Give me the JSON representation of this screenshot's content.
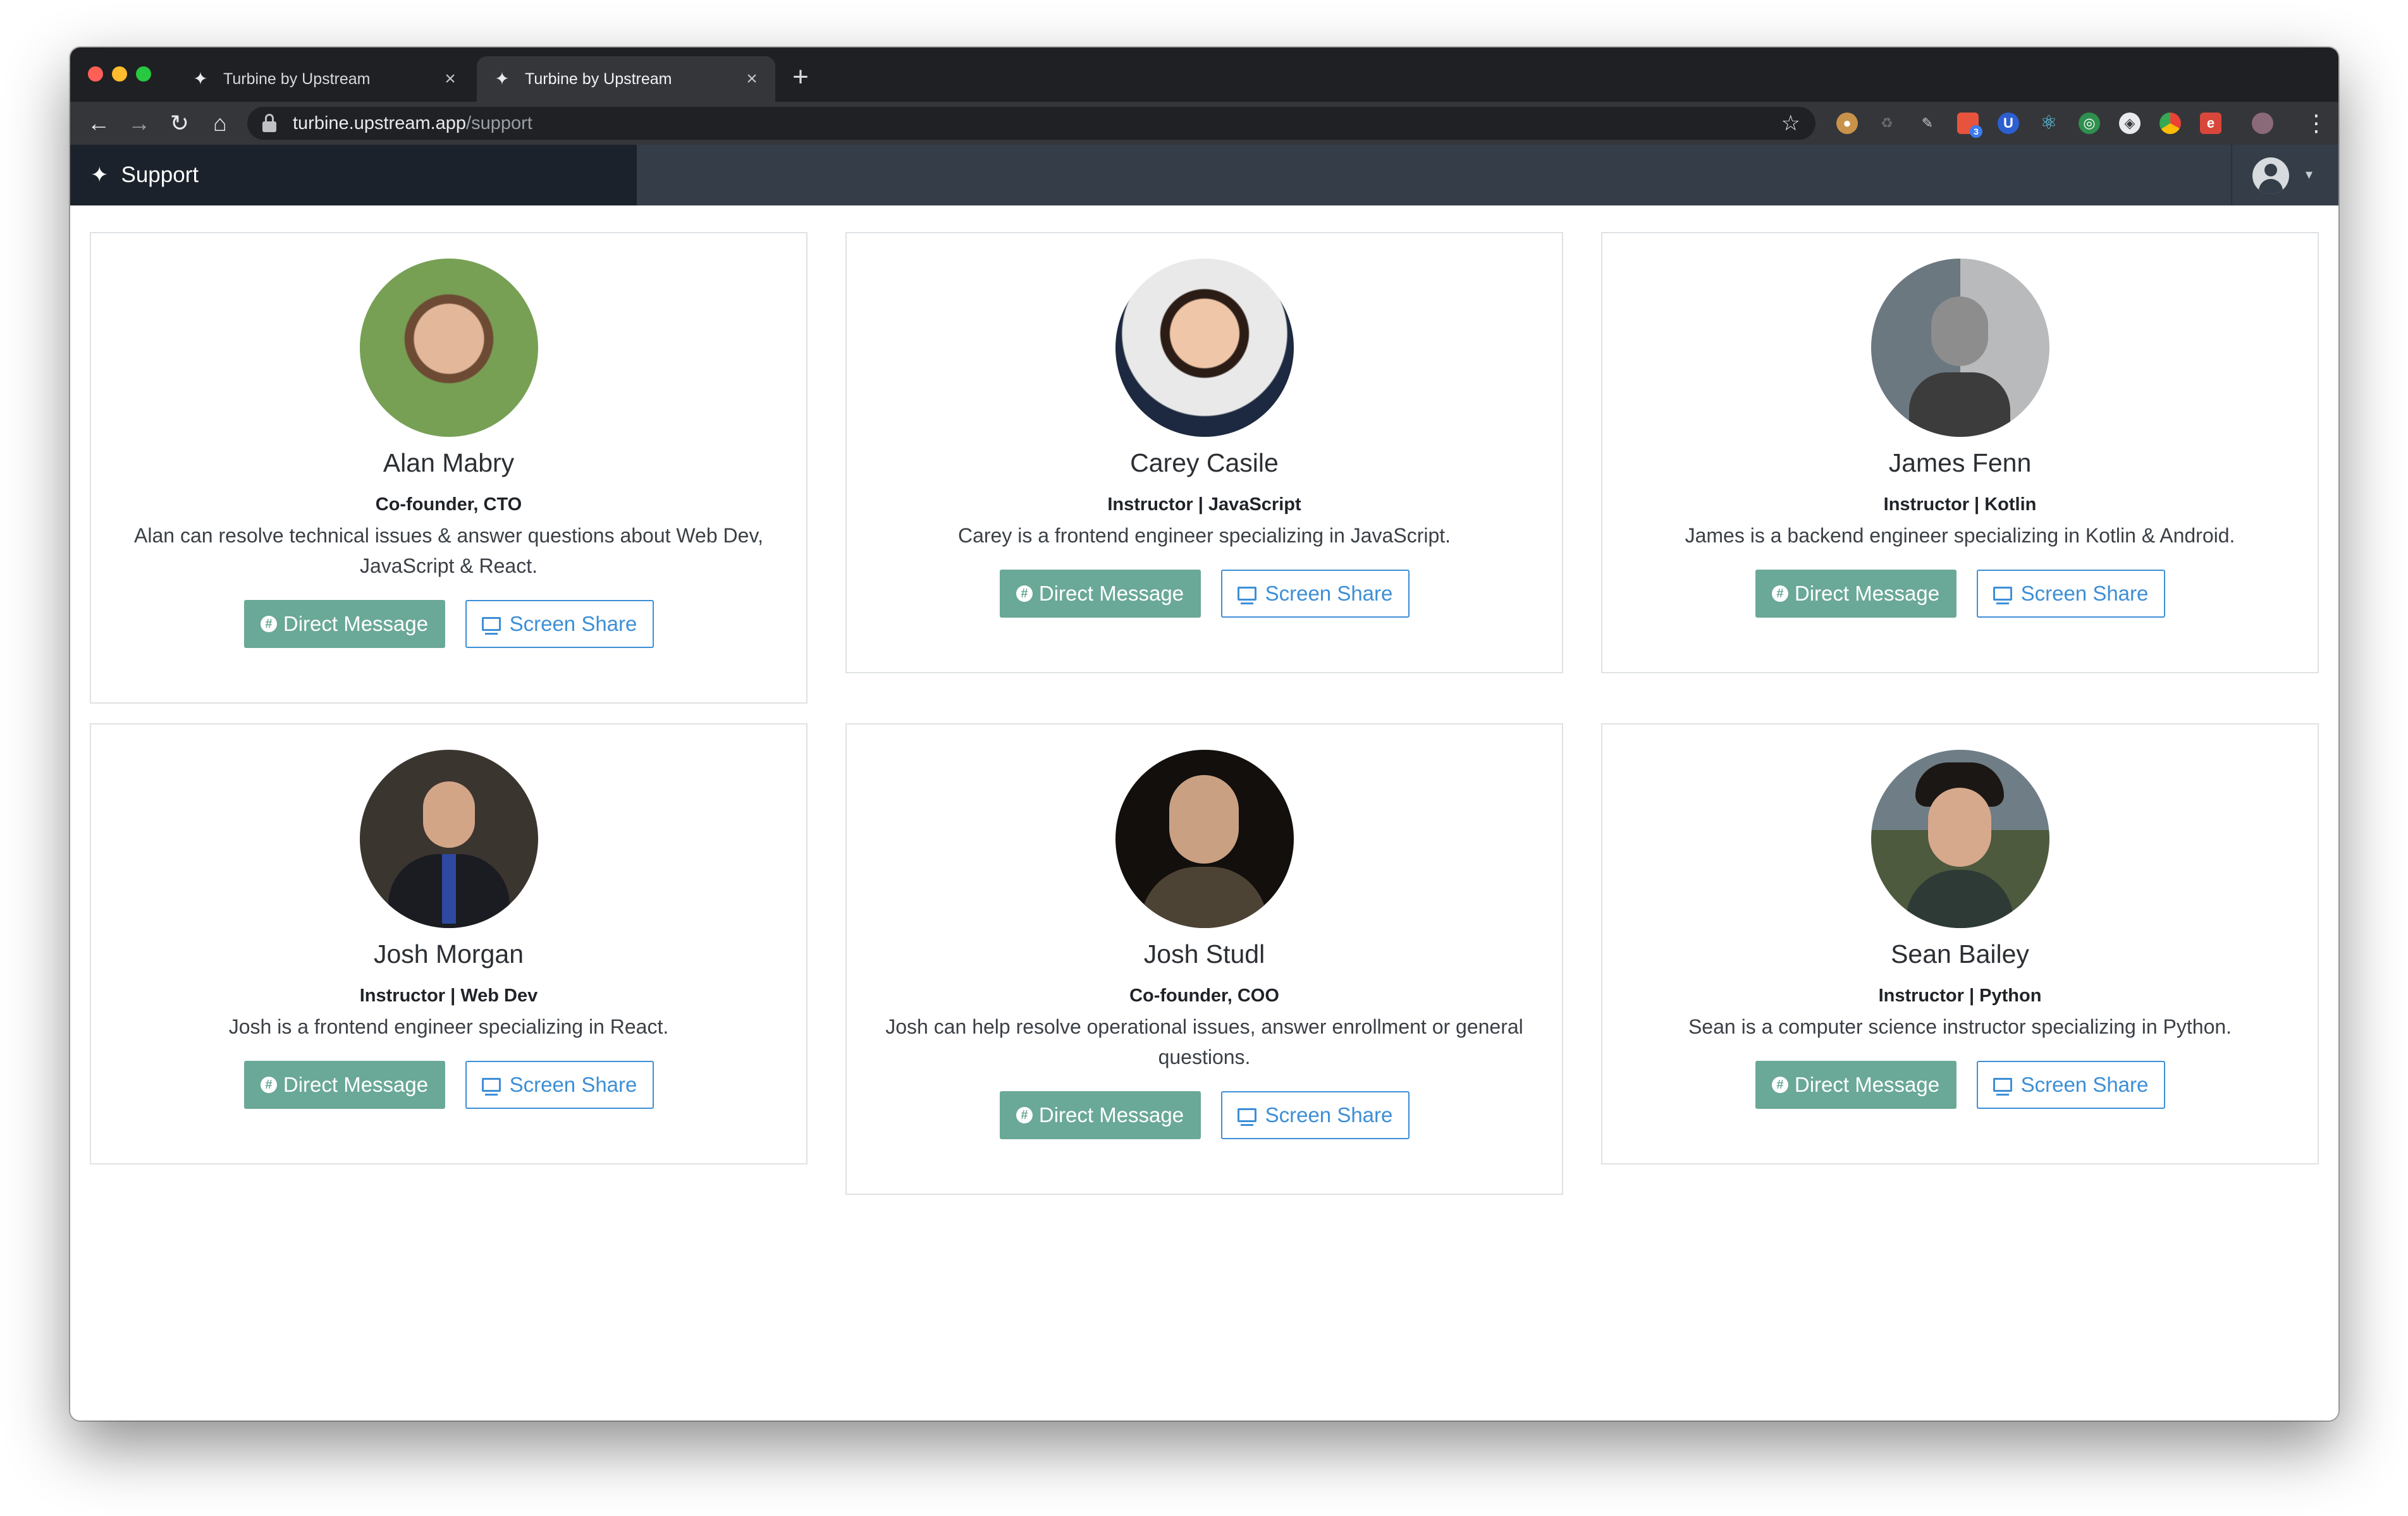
{
  "browser": {
    "tabs": [
      {
        "title": "Turbine by Upstream",
        "active": false
      },
      {
        "title": "Turbine by Upstream",
        "active": true
      }
    ],
    "url_host": "turbine.upstream.app",
    "url_path": "/support",
    "extension_icons": [
      "cookie-icon",
      "recycle-icon",
      "pen-icon",
      "extension-badge-icon",
      "upstream-u-icon",
      "react-icon",
      "target-icon",
      "compass-icon",
      "chrome-icon",
      "e-icon",
      "profile-avatar-icon"
    ],
    "extension_badge_count": "3"
  },
  "app": {
    "section_title": "Support"
  },
  "buttons": {
    "direct_message": "Direct Message",
    "screen_share": "Screen Share"
  },
  "team": [
    {
      "name": "Alan Mabry",
      "role": "Co-founder, CTO",
      "bio": "Alan can resolve technical issues & answer questions about Web Dev, JavaScript & React."
    },
    {
      "name": "Carey Casile",
      "role": "Instructor | JavaScript",
      "bio": "Carey is a frontend engineer specializing in JavaScript."
    },
    {
      "name": "James Fenn",
      "role": "Instructor | Kotlin",
      "bio": "James is a backend engineer specializing in Kotlin & Android."
    },
    {
      "name": "Josh Morgan",
      "role": "Instructor | Web Dev",
      "bio": "Josh is a frontend engineer specializing in React."
    },
    {
      "name": "Josh Studl",
      "role": "Co-founder, COO",
      "bio": "Josh can help resolve operational issues, answer enrollment or general questions."
    },
    {
      "name": "Sean Bailey",
      "role": "Instructor | Python",
      "bio": "Sean is a computer science instructor specializing in Python."
    }
  ],
  "colors": {
    "direct_message_bg": "#6aa897",
    "screen_share_accent": "#3d8fd6",
    "app_header": "#353d48",
    "app_brand_bg": "#1c222b"
  }
}
